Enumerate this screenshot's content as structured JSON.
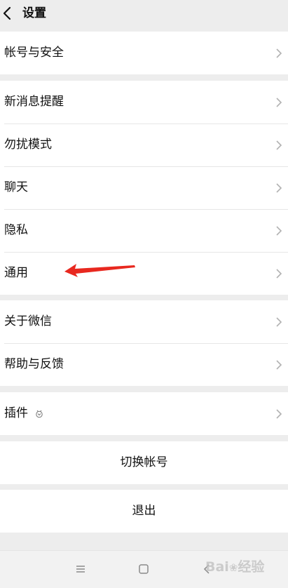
{
  "header": {
    "title": "设置",
    "back_icon": "chevron-left-icon"
  },
  "groups": [
    {
      "items": [
        {
          "label": "帐号与安全"
        }
      ]
    },
    {
      "items": [
        {
          "label": "新消息提醒"
        },
        {
          "label": "勿扰模式"
        },
        {
          "label": "聊天"
        },
        {
          "label": "隐私"
        },
        {
          "label": "通用"
        }
      ]
    },
    {
      "items": [
        {
          "label": "关于微信"
        },
        {
          "label": "帮助与反馈"
        }
      ]
    },
    {
      "items": [
        {
          "label": "插件",
          "icon": "plugin-badge-icon"
        }
      ]
    }
  ],
  "actions": {
    "switch_account": "切换帐号",
    "logout": "退出"
  },
  "annotation": {
    "color": "#e8281f",
    "points_to": "通用"
  },
  "nav": [
    "menu-icon",
    "home-icon",
    "back-icon"
  ],
  "watermark": {
    "brand": "Bai",
    "suffix": "经验"
  },
  "colors": {
    "background": "#ededed",
    "row": "#ffffff",
    "text": "#111111",
    "chevron": "#b2b2b2",
    "arrow": "#e8281f"
  }
}
